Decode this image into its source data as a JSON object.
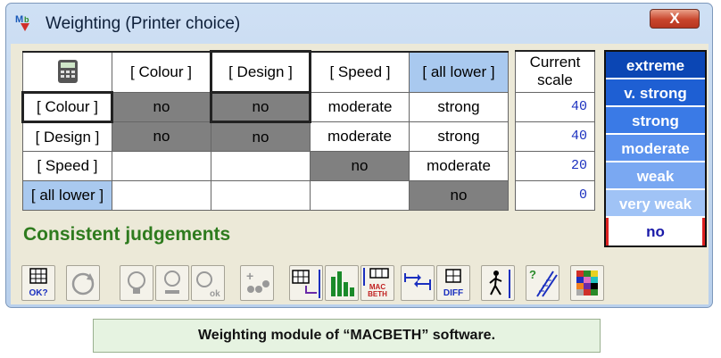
{
  "window": {
    "title": "Weighting (Printer choice)",
    "close_label": "X"
  },
  "matrix": {
    "column_headers": [
      "[ Colour ]",
      "[ Design ]",
      "[ Speed ]",
      "[ all lower ]"
    ],
    "rows": [
      {
        "label": "[ Colour ]",
        "cells": [
          "no",
          "no",
          "moderate",
          "strong"
        ]
      },
      {
        "label": "[ Design ]",
        "cells": [
          "no",
          "no",
          "moderate",
          "strong"
        ]
      },
      {
        "label": "[ Speed ]",
        "cells": [
          "",
          "",
          "no",
          "moderate"
        ]
      },
      {
        "label": "[ all lower ]",
        "cells": [
          "",
          "",
          "",
          "no"
        ]
      }
    ]
  },
  "scale": {
    "header_line1": "Current",
    "header_line2": "scale",
    "values": [
      "40",
      "40",
      "20",
      "0"
    ]
  },
  "legend": [
    "extreme",
    "v. strong",
    "strong",
    "moderate",
    "weak",
    "very weak",
    "no"
  ],
  "status": "Consistent judgements",
  "toolbar": {
    "ok_label": "OK?",
    "macbeth_label": "MAC BETH",
    "diff_label": "DIFF"
  },
  "caption": "Weighting module of “MACBETH” software.",
  "colors": {
    "diagonal_gray": "#808080",
    "lower_header": "#a9c9ef",
    "status_green": "#2e7b1e",
    "scale_blue": "#1a2fbf"
  }
}
